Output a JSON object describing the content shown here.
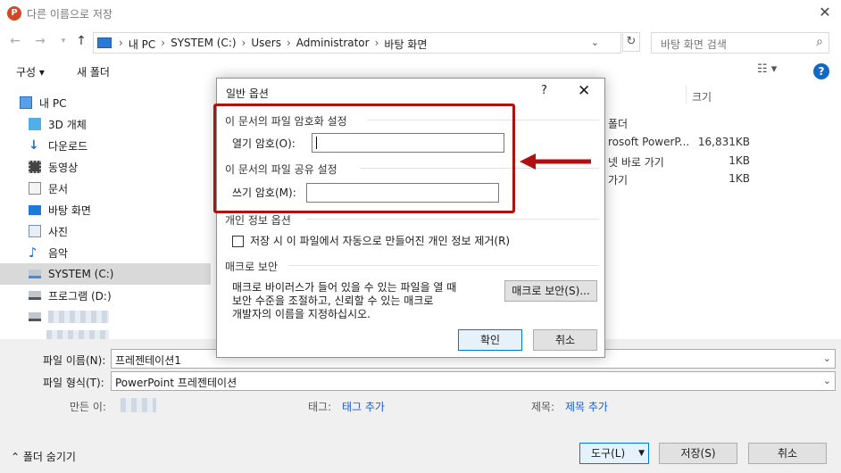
{
  "window": {
    "title": "다른 이름으로 저장",
    "app_icon": "P"
  },
  "nav": {
    "breadcrumbs": [
      "내 PC",
      "SYSTEM (C:)",
      "Users",
      "Administrator",
      "바탕 화면"
    ],
    "search_placeholder": "바탕 화면 검색"
  },
  "toolbar": {
    "organize": "구성 ▾",
    "new_folder": "새 폴더",
    "help": "?"
  },
  "sidebar": {
    "items": [
      {
        "label": "내 PC"
      },
      {
        "label": "3D 개체"
      },
      {
        "label": "다운로드"
      },
      {
        "label": "동영상"
      },
      {
        "label": "문서"
      },
      {
        "label": "바탕 화면"
      },
      {
        "label": "사진"
      },
      {
        "label": "음악"
      },
      {
        "label": "SYSTEM (C:)"
      },
      {
        "label": "프로그램 (D:)"
      }
    ]
  },
  "file_list": {
    "size_header": "크기",
    "rows": [
      {
        "text": "폴더",
        "size": ""
      },
      {
        "text": "rosoft PowerP...",
        "size": "16,831KB"
      },
      {
        "text": "넷 바로 가기",
        "size": "1KB"
      },
      {
        "text": "가기",
        "size": "1KB"
      }
    ]
  },
  "save_panel": {
    "filename_label": "파일 이름(N):",
    "filename_value": "프레젠테이션1",
    "filetype_label": "파일 형식(T):",
    "filetype_value": "PowerPoint 프레젠테이션",
    "author_label": "만든 이:",
    "tags_label": "태그:",
    "tags_link": "태그 추가",
    "title_label": "제목:",
    "title_link": "제목 추가",
    "hide_folders": "폴더 숨기기",
    "tools_button": "도구(L)",
    "save_button": "저장(S)",
    "cancel_button": "취소"
  },
  "dialog": {
    "title": "일반 옵션",
    "help": "?",
    "encrypt_section": "이 문서의 파일 암호화 설정",
    "open_password_label": "열기 암호(O):",
    "sharing_section": "이 문서의 파일 공유 설정",
    "modify_password_label": "쓰기 암호(M):",
    "privacy_section": "개인 정보 옵션",
    "privacy_checkbox": "저장 시 이 파일에서 자동으로 만들어진 개인 정보 제거(R)",
    "macro_section": "매크로 보안",
    "macro_text_1": "매크로 바이러스가 들어 있을 수 있는 파일을 열 때",
    "macro_text_2": "보안 수준을 조절하고, 신뢰할 수 있는 매크로",
    "macro_text_3": "개발자의 이름을 지정하십시오.",
    "macro_button": "매크로 보안(S)...",
    "ok_button": "확인",
    "cancel_button": "취소"
  },
  "colors": {
    "annotation": "#b01010",
    "accent": "#0078d7"
  }
}
